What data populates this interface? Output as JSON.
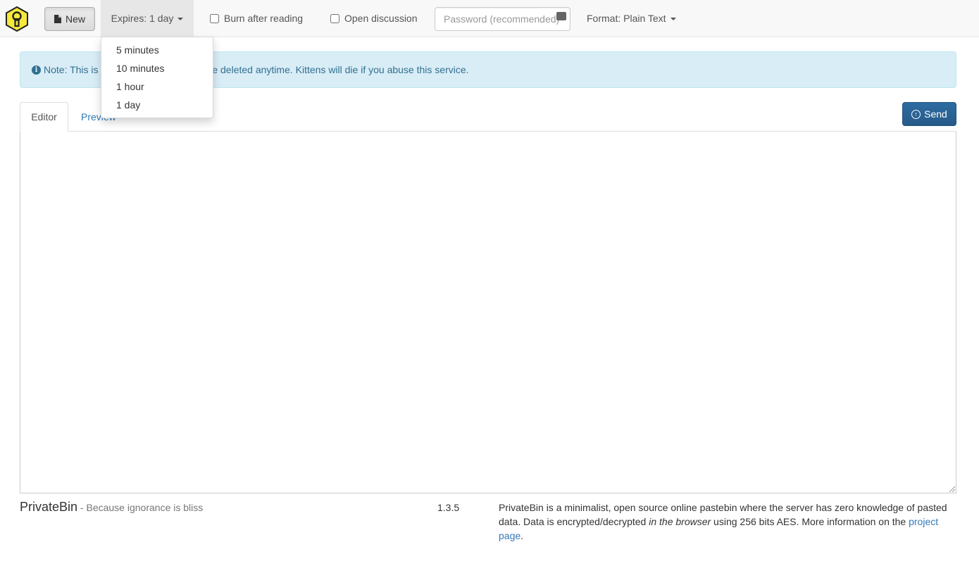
{
  "navbar": {
    "logo_icon": "privatebin-keyhole-logo",
    "new_label": "New",
    "expires_label": "Expires: 1 day",
    "burn_label": "Burn after reading",
    "discussion_label": "Open discussion",
    "password_placeholder": "Password (recommended)",
    "format_label": "Format: Plain Text"
  },
  "expires_menu": {
    "options": [
      "5 minutes",
      "10 minutes",
      "1 hour",
      "1 day"
    ],
    "selected": "1 day"
  },
  "alert": {
    "prefix": "Note: This is ",
    "suffix": "be deleted anytime. Kittens will die if you abuse this service."
  },
  "tabs": {
    "editor": "Editor",
    "preview": "Preview"
  },
  "send_label": "Send",
  "editor": {
    "value": ""
  },
  "footer": {
    "brand": "PrivateBin",
    "tagline": " - Because ignorance is bliss",
    "version": "1.3.5",
    "about_part1": "PrivateBin is a minimalist, open source online pastebin where the server has zero knowledge of pasted data. Data is encrypted/decrypted ",
    "about_emphasis": "in the browser",
    "about_part2": " using 256 bits AES. More information on the ",
    "about_link": "project page",
    "about_end": "."
  },
  "colors": {
    "accent_blue": "#337ab7",
    "send_button": "#265a88",
    "alert_bg": "#d9edf7",
    "alert_text": "#31708f",
    "logo_yellow": "#f6e93c"
  }
}
